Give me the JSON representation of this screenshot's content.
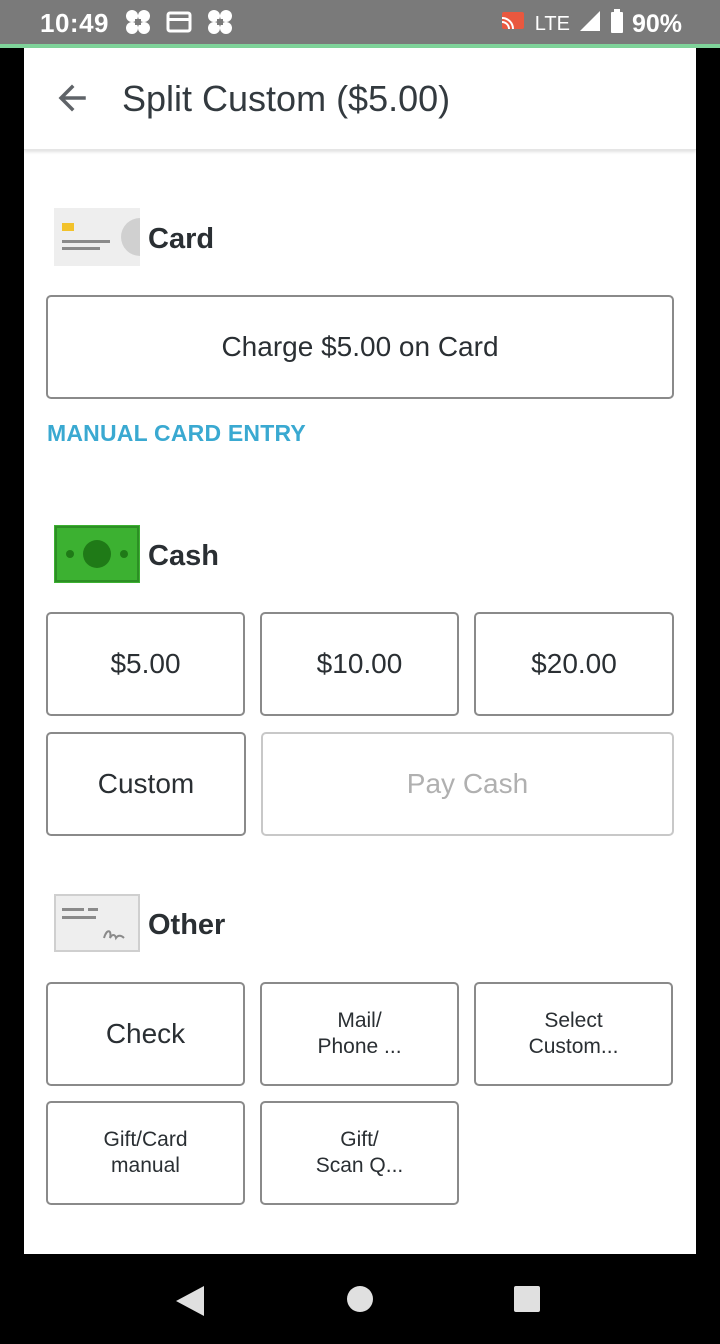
{
  "status_bar": {
    "time": "10:49",
    "network": "LTE",
    "battery": "90%"
  },
  "header": {
    "title": "Split Custom ($5.00)"
  },
  "card_section": {
    "label": "Card",
    "charge_button": "Charge $5.00 on Card",
    "manual_entry_link": "MANUAL CARD ENTRY"
  },
  "cash_section": {
    "label": "Cash",
    "amounts": [
      "$5.00",
      "$10.00",
      "$20.00"
    ],
    "custom_button": "Custom",
    "pay_cash_button": "Pay Cash"
  },
  "other_section": {
    "label": "Other",
    "check_button": "Check",
    "mail_phone_line1": "Mail/",
    "mail_phone_line2": "Phone ...",
    "select_custom_line1": "Select",
    "select_custom_line2": "Custom...",
    "gift_manual_line1": "Gift/Card",
    "gift_manual_line2": "manual",
    "gift_scan_line1": "Gift/",
    "gift_scan_line2": "Scan Q..."
  },
  "colors": {
    "link": "#3aa9d1",
    "cash_green": "#3cb131",
    "status_bar": "#7a7a7a"
  }
}
